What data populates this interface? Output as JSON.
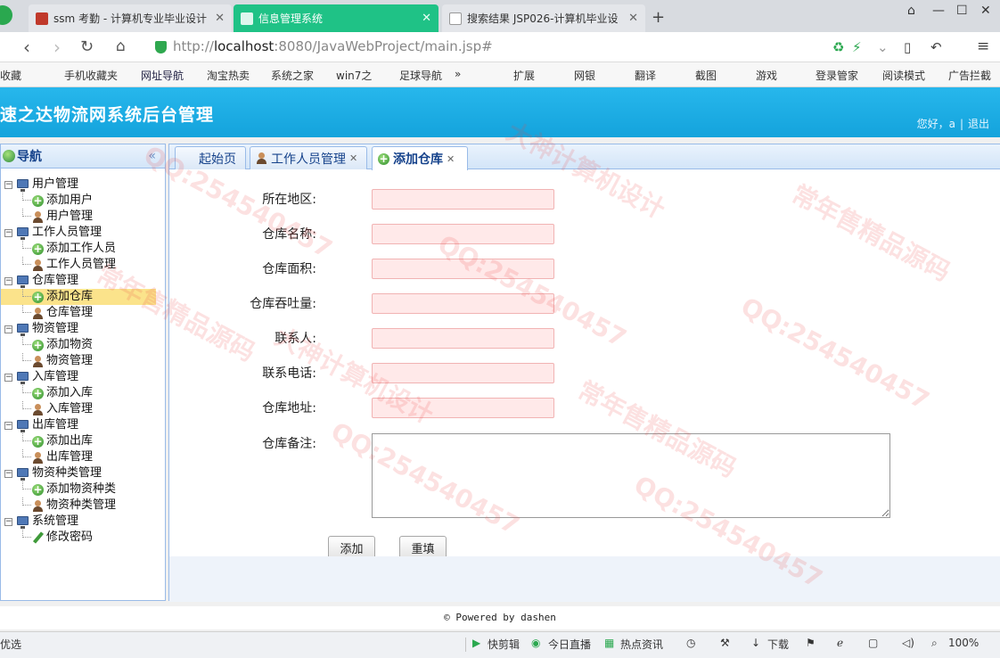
{
  "browser": {
    "tabs": [
      {
        "title": "ssm 考勤 - 计算机专业毕业设计"
      },
      {
        "title": "信息管理系统"
      },
      {
        "title": "搜索结果 JSP026-计算机毕业设"
      }
    ],
    "url_host": "http://",
    "url_domain": "localhost",
    "url_path": ":8080/JavaWebProject/main.jsp#",
    "bookmarks": [
      "收藏",
      "手机收藏夹",
      "网址导航",
      "淘宝热卖",
      "系统之家",
      "win7之",
      "足球导航",
      "»",
      "扩展",
      "网银",
      "翻译",
      "截图",
      "游戏",
      "登录管家",
      "阅读模式",
      "广告拦截"
    ]
  },
  "app": {
    "title": "速之达物流网系统后台管理",
    "greeting": "您好，a",
    "sep": "|",
    "logout": "退出"
  },
  "nav": {
    "title": "导航",
    "collapse": "«",
    "groups": [
      {
        "label": "用户管理",
        "items": [
          {
            "label": "添加用户",
            "icon": "add-icon"
          },
          {
            "label": "用户管理",
            "icon": "user-icon"
          }
        ]
      },
      {
        "label": "工作人员管理",
        "items": [
          {
            "label": "添加工作人员",
            "icon": "add-icon"
          },
          {
            "label": "工作人员管理",
            "icon": "user-icon"
          }
        ]
      },
      {
        "label": "仓库管理",
        "items": [
          {
            "label": "添加仓库",
            "icon": "add-icon"
          },
          {
            "label": "仓库管理",
            "icon": "user-icon"
          }
        ]
      },
      {
        "label": "物资管理",
        "items": [
          {
            "label": "添加物资",
            "icon": "add-icon"
          },
          {
            "label": "物资管理",
            "icon": "user-icon"
          }
        ]
      },
      {
        "label": "入库管理",
        "items": [
          {
            "label": "添加入库",
            "icon": "add-icon"
          },
          {
            "label": "入库管理",
            "icon": "user-icon"
          }
        ]
      },
      {
        "label": "出库管理",
        "items": [
          {
            "label": "添加出库",
            "icon": "add-icon"
          },
          {
            "label": "出库管理",
            "icon": "user-icon"
          }
        ]
      },
      {
        "label": "物资种类管理",
        "items": [
          {
            "label": "添加物资种类",
            "icon": "add-icon"
          },
          {
            "label": "物资种类管理",
            "icon": "user-icon"
          }
        ]
      },
      {
        "label": "系统管理",
        "items": [
          {
            "label": "修改密码",
            "icon": "pencil-icon"
          }
        ]
      }
    ],
    "selected": "添加仓库"
  },
  "content_tabs": [
    {
      "label": "起始页",
      "closable": false
    },
    {
      "label": "工作人员管理",
      "closable": true
    },
    {
      "label": "添加仓库",
      "closable": true
    }
  ],
  "form": {
    "fields": [
      {
        "label": "所在地区:",
        "value": ""
      },
      {
        "label": "仓库名称:",
        "value": ""
      },
      {
        "label": "仓库面积:",
        "value": ""
      },
      {
        "label": "仓库吞吐量:",
        "value": ""
      },
      {
        "label": "联系人:",
        "value": ""
      },
      {
        "label": "联系电话:",
        "value": ""
      },
      {
        "label": "仓库地址:",
        "value": ""
      }
    ],
    "notes_label": "仓库备注:",
    "notes_value": "",
    "submit_label": "添加",
    "reset_label": "重填"
  },
  "footer": {
    "powered_by": "Powered by dashen"
  },
  "statusbar": {
    "left": "优选",
    "items": [
      "快剪辑",
      "今日直播",
      "热点资讯",
      "下载",
      "100%"
    ]
  },
  "watermark": {
    "qq": "QQ:254540457",
    "line1": "大神计算机设计",
    "line2": "常年售精品源码"
  },
  "colors": {
    "header_blue": "#14a3dc",
    "active_browser_tab": "#1fc286",
    "input_error_bg": "#ffe9e9",
    "selected_nav": "#fbe38b"
  }
}
